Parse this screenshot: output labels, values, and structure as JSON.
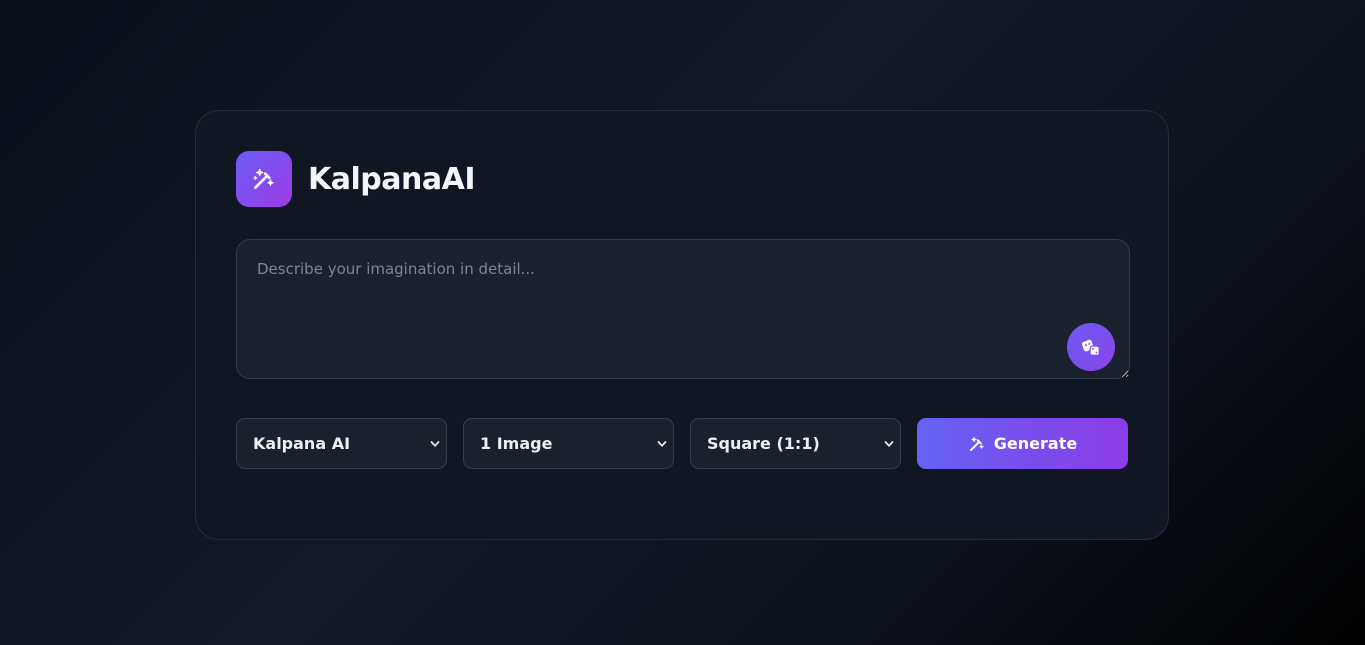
{
  "app": {
    "name": "KalpanaAI",
    "logo_icon": "wand-sparkles-icon",
    "accent_start": "#6d5cf5",
    "accent_end": "#9b3ce6"
  },
  "prompt": {
    "value": "",
    "placeholder": "Describe your imagination in detail...",
    "random_button_icon": "dice-icon"
  },
  "controls": {
    "model_select": {
      "selected": "Kalpana AI"
    },
    "count_select": {
      "selected": "1 Image"
    },
    "ratio_select": {
      "selected": "Square (1:1)"
    },
    "generate_button": {
      "label": "Generate",
      "icon": "wand-sparkles-icon"
    }
  }
}
